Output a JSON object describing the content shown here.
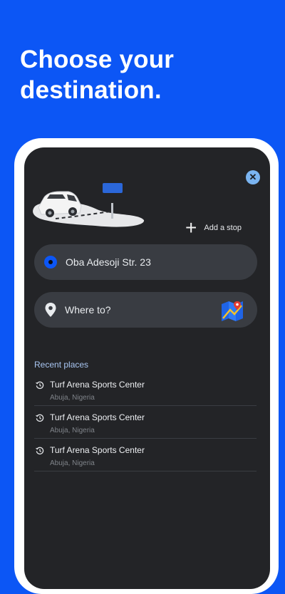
{
  "headline": "Choose your destination.",
  "close_glyph": "✕",
  "add_stop": {
    "label": "Add a stop",
    "icon": "plus-icon"
  },
  "origin": {
    "value": "Oba Adesoji Str. 23",
    "icon": "origin-dot-icon"
  },
  "destination": {
    "placeholder": "Where to?",
    "icon": "location-pin-icon",
    "map_icon": "map-pin-icon"
  },
  "recent": {
    "title": "Recent places",
    "items": [
      {
        "name": "Turf Arena Sports Center",
        "location": "Abuja, Nigeria"
      },
      {
        "name": "Turf Arena Sports Center",
        "location": "Abuja, Nigeria"
      },
      {
        "name": "Turf Arena Sports Center",
        "location": "Abuja, Nigeria"
      }
    ]
  },
  "colors": {
    "brand_blue": "#0c56f5",
    "screen_bg": "#232427",
    "field_bg": "#393c42",
    "accent_light_blue": "#a9c6f2"
  }
}
